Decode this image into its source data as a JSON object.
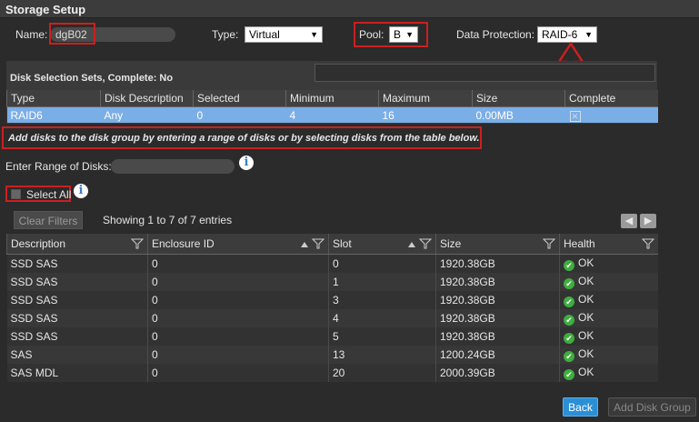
{
  "window": {
    "title": "Storage Setup"
  },
  "form": {
    "name_label": "Name:",
    "name_value": "dgB02",
    "type_label": "Type:",
    "type_value": "Virtual",
    "pool_label": "Pool:",
    "pool_value": "B",
    "protection_label": "Data Protection:",
    "protection_value": "RAID-6"
  },
  "disk_sets": {
    "title": "Disk Selection Sets, Complete: No",
    "columns": [
      "Type",
      "Disk Description",
      "Selected",
      "Minimum",
      "Maximum",
      "Size",
      "Complete"
    ],
    "rows": [
      {
        "type": "RAID6",
        "description": "Any",
        "selected": "0",
        "minimum": "4",
        "maximum": "16",
        "size": "0.00MB"
      }
    ]
  },
  "notice": "Add disks to the disk group by entering a range of disks or by selecting disks from the table below.",
  "range": {
    "label": "Enter Range of Disks:"
  },
  "select_all_label": "Select All",
  "clear_filters_label": "Clear Filters",
  "entries_text": "Showing 1 to 7 of 7 entries",
  "disks": {
    "columns": [
      "Description",
      "Enclosure ID",
      "Slot",
      "Size",
      "Health"
    ],
    "rows": [
      {
        "description": "SSD SAS",
        "enclosure": "0",
        "slot": "0",
        "size": "1920.38GB",
        "health": "OK"
      },
      {
        "description": "SSD SAS",
        "enclosure": "0",
        "slot": "1",
        "size": "1920.38GB",
        "health": "OK"
      },
      {
        "description": "SSD SAS",
        "enclosure": "0",
        "slot": "3",
        "size": "1920.38GB",
        "health": "OK"
      },
      {
        "description": "SSD SAS",
        "enclosure": "0",
        "slot": "4",
        "size": "1920.38GB",
        "health": "OK"
      },
      {
        "description": "SSD SAS",
        "enclosure": "0",
        "slot": "5",
        "size": "1920.38GB",
        "health": "OK"
      },
      {
        "description": "SAS",
        "enclosure": "0",
        "slot": "13",
        "size": "1200.24GB",
        "health": "OK"
      },
      {
        "description": "SAS MDL",
        "enclosure": "0",
        "slot": "20",
        "size": "2000.39GB",
        "health": "OK"
      }
    ]
  },
  "footer": {
    "back_label": "Back",
    "add_label": "Add Disk Group"
  },
  "colors": {
    "highlight": "#cc1f1f",
    "selected_row": "#7aaee6",
    "primary_button": "#2b8fd6",
    "ok_green": "#3fae3f"
  },
  "icons": {
    "info": "info-icon",
    "filter": "filter-icon",
    "sort": "sort-asc-icon",
    "health": "check-circle-icon",
    "prev": "arrow-left-icon",
    "next": "arrow-right-icon"
  }
}
